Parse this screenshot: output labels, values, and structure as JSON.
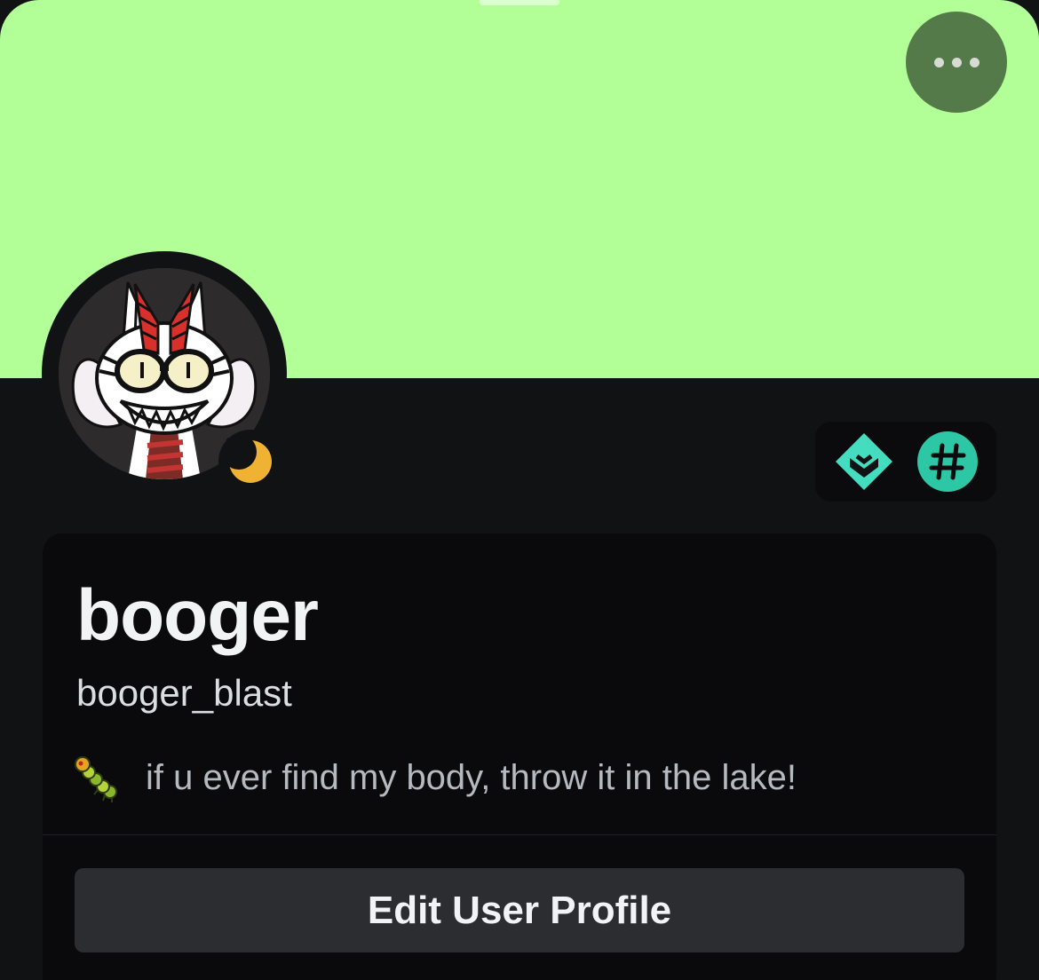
{
  "profile": {
    "banner_color": "#b2ff98",
    "more_button_color": "#557a4a",
    "display_name": "booger",
    "username": "booger_blast",
    "status": "idle",
    "status_color": "#f0b232",
    "custom_status": {
      "emoji": "caterpillar-emoji",
      "text": "if u ever find my body, throw it in the lake!"
    },
    "avatar": "cartoon-cat-grinning-avatar",
    "badges": [
      {
        "icon": "hypesquad-badge-icon",
        "color": "#45ddc0"
      },
      {
        "icon": "hashtag-badge-icon",
        "color": "#2dc7a5"
      }
    ],
    "edit_button_label": "Edit User Profile"
  }
}
